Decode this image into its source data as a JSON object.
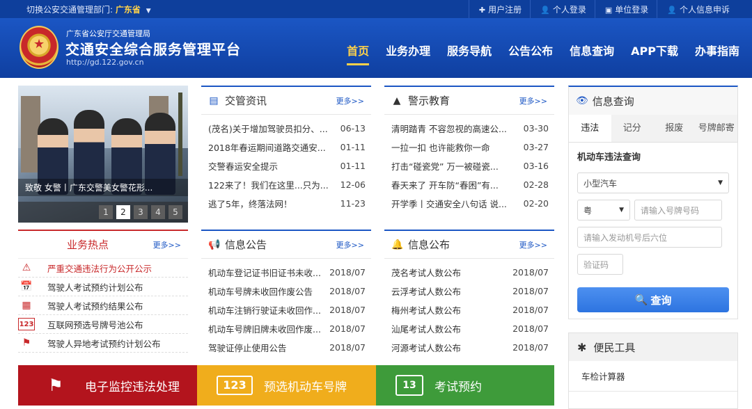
{
  "topbar": {
    "switch_label": "切换公安交通管理部门:",
    "province": "广东省",
    "links": [
      {
        "icon": "plus-icon",
        "glyph": "✚",
        "label": "用户注册"
      },
      {
        "icon": "user-icon",
        "glyph": "👤",
        "label": "个人登录"
      },
      {
        "icon": "building-icon",
        "glyph": "▣",
        "label": "单位登录"
      },
      {
        "icon": "person-icon",
        "glyph": "👤",
        "label": "个人信息申诉"
      }
    ]
  },
  "header": {
    "org": "广东省公安厅交通管理局",
    "title": "交通安全综合服务管理平台",
    "url": "http://gd.122.gov.cn",
    "nav": [
      "首页",
      "业务办理",
      "服务导航",
      "公告公布",
      "信息查询",
      "APP下载",
      "办事指南"
    ]
  },
  "slider": {
    "caption": "致敬 女警丨广东交警美女警花形...",
    "pages": [
      "1",
      "2",
      "3",
      "4",
      "5"
    ],
    "active_page": "2"
  },
  "news": {
    "title": "交管资讯",
    "more": "更多>>",
    "items": [
      {
        "title": "(茂名)关于增加驾驶员扣分、...",
        "date": "06-13"
      },
      {
        "title": "2018年春运期间道路交通安...",
        "date": "01-11"
      },
      {
        "title": "交警春运安全提示",
        "date": "01-11"
      },
      {
        "title": "122来了！我们在这里...只为...",
        "date": "12-06"
      },
      {
        "title": "逃了5年，终落法网！",
        "date": "11-23"
      }
    ]
  },
  "warning": {
    "title": "警示教育",
    "more": "更多>>",
    "items": [
      {
        "title": "清明踏青 不容忽视的高速公...",
        "date": "03-30"
      },
      {
        "title": "一拉一扣 也许能救你一命",
        "date": "03-27"
      },
      {
        "title": "打击“碰瓷党” 万一被碰瓷...",
        "date": "03-16"
      },
      {
        "title": "春天来了 开车防“春困”有...",
        "date": "02-28"
      },
      {
        "title": "开学季丨交通安全八句话 说...",
        "date": "02-20"
      }
    ]
  },
  "hot": {
    "title": "业务热点",
    "more": "更多>>",
    "items": [
      {
        "icon": "warning-triangle-icon",
        "glyph": "⚠",
        "label": "严重交通违法行为公开公示"
      },
      {
        "icon": "calendar-icon",
        "glyph": "📅",
        "label": "驾驶人考试预约计划公布"
      },
      {
        "icon": "calendar-grid-icon",
        "glyph": "▦",
        "label": "驾驶人考试预约结果公布"
      },
      {
        "icon": "number-plate-icon",
        "glyph": "123",
        "label": "互联网预选号牌号池公布"
      },
      {
        "icon": "flag-icon",
        "glyph": "⚑",
        "label": "驾驶人异地考试预约计划公布"
      }
    ]
  },
  "notice": {
    "title": "信息公告",
    "more": "更多>>",
    "items": [
      {
        "title": "机动车登记证书旧证书未收...",
        "date": "2018/07"
      },
      {
        "title": "机动车号牌未收回作废公告",
        "date": "2018/07"
      },
      {
        "title": "机动车注销行驶证未收回作...",
        "date": "2018/07"
      },
      {
        "title": "机动车号牌旧牌未收回作废...",
        "date": "2018/07"
      },
      {
        "title": "驾驶证停止使用公告",
        "date": "2018/07"
      }
    ]
  },
  "publish": {
    "title": "信息公布",
    "more": "更多>>",
    "items": [
      {
        "title": "茂名考试人数公布",
        "date": "2018/07"
      },
      {
        "title": "云浮考试人数公布",
        "date": "2018/07"
      },
      {
        "title": "梅州考试人数公布",
        "date": "2018/07"
      },
      {
        "title": "汕尾考试人数公布",
        "date": "2018/07"
      },
      {
        "title": "河源考试人数公布",
        "date": "2018/07"
      }
    ]
  },
  "query": {
    "title": "信息查询",
    "tabs": [
      "违法",
      "记分",
      "报废",
      "号牌邮寄"
    ],
    "active_tab": "违法",
    "subtitle": "机动车违法查询",
    "vehicle_type": "小型汽车",
    "province_prefix": "粤",
    "plate_placeholder": "请输入号牌号码",
    "engine_placeholder": "请输入发动机号后六位",
    "captcha_placeholder": "验证码",
    "button": "查询"
  },
  "tools": {
    "title": "便民工具",
    "items": [
      "车检计算器"
    ]
  },
  "banners": [
    {
      "icon": "camera-flag-icon",
      "glyph": "⚑",
      "label": "电子监控违法处理",
      "color": "#b3141d"
    },
    {
      "icon": "plate-number-icon",
      "glyph": "123",
      "label": "预选机动车号牌",
      "color": "#f0ad1c"
    },
    {
      "icon": "calendar-13-icon",
      "glyph": "13",
      "label": "考试预约",
      "color": "#3e9b3a"
    }
  ],
  "colors": {
    "brand_blue": "#1b56c4",
    "topbar_blue": "#0e3f9c",
    "accent_yellow": "#ffd24a",
    "hot_red": "#c8282a"
  }
}
